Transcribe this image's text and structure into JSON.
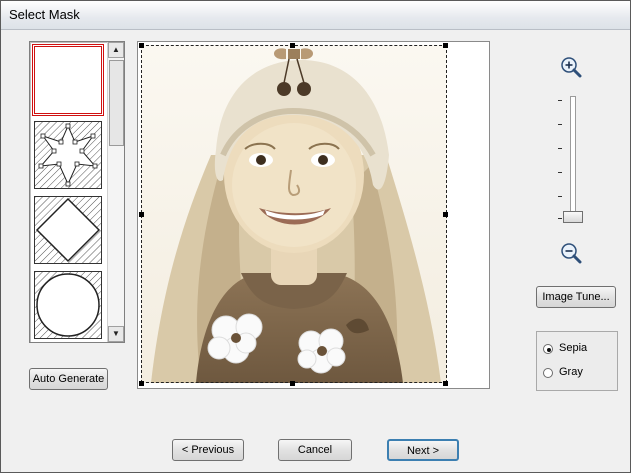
{
  "window": {
    "title": "Select Mask"
  },
  "mask_list": {
    "items": [
      {
        "name": "no-mask",
        "selected": true
      },
      {
        "name": "star-mask",
        "selected": false
      },
      {
        "name": "diamond-mask",
        "selected": false
      },
      {
        "name": "circle-mask",
        "selected": false
      }
    ],
    "scroll_up": "▲",
    "scroll_down": "▼"
  },
  "buttons": {
    "auto_generate": "Auto Generate",
    "image_tune": "Image Tune...",
    "previous": "< Previous",
    "cancel": "Cancel",
    "next": "Next >"
  },
  "zoom": {
    "zoom_in_icon": "zoom-in-icon",
    "zoom_out_icon": "zoom-out-icon",
    "level_fraction": 0
  },
  "color_mode": {
    "options": [
      {
        "label": "Sepia",
        "selected": true
      },
      {
        "label": "Gray",
        "selected": false
      }
    ]
  },
  "colors": {
    "selection_border": "#d01010",
    "sepia_light": "#f3ead6",
    "sepia_dark": "#5e4a33"
  }
}
